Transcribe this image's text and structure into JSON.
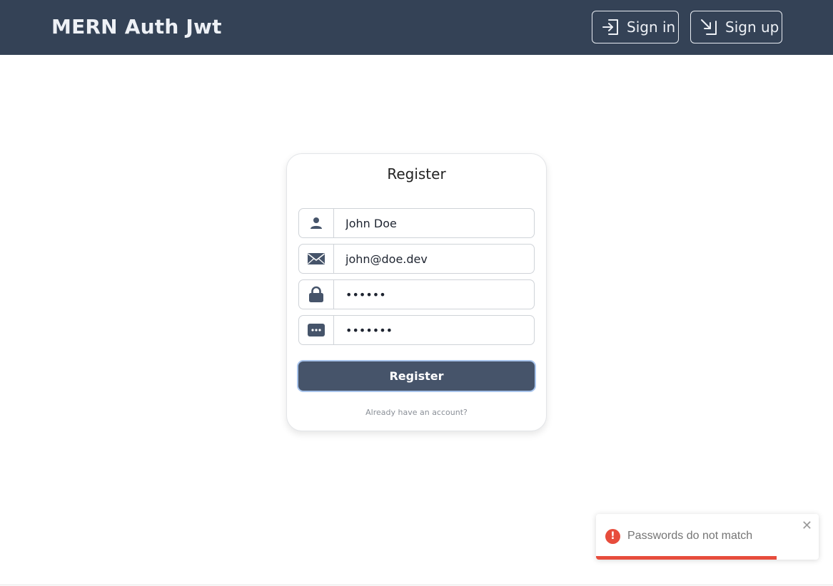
{
  "navbar": {
    "brand": "MERN Auth Jwt",
    "signin_label": "Sign in",
    "signup_label": "Sign up",
    "signin_icon": "login-icon",
    "signup_icon": "signup-arrow-icon",
    "background": "#344256"
  },
  "form": {
    "title": "Register",
    "name_value": "John Doe",
    "email_value": "john@doe.dev",
    "password_value": "••••••",
    "confirm_value": "•••••••",
    "name_icon": "user-icon",
    "email_icon": "envelope-icon",
    "password_icon": "lock-icon",
    "confirm_icon": "dots-icon",
    "submit_label": "Register",
    "already_link": "Already have an account?"
  },
  "toast": {
    "message": "Passwords do not match",
    "icon": "error-icon",
    "close_glyph": "✕",
    "progress": 0.81,
    "color": "#e74c3c"
  }
}
